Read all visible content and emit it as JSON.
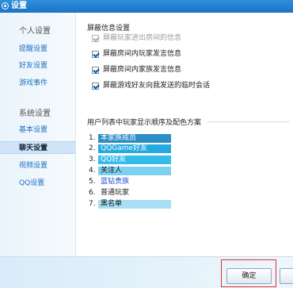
{
  "window": {
    "title": "设置"
  },
  "sidebar": {
    "groups": [
      {
        "label": "个人设置",
        "items": [
          {
            "label": "提醒设置"
          },
          {
            "label": "好友设置"
          },
          {
            "label": "游戏事件"
          }
        ]
      },
      {
        "label": "系统设置",
        "items": [
          {
            "label": "基本设置"
          },
          {
            "label": "聊天设置",
            "active": true
          },
          {
            "label": "视频设置"
          },
          {
            "label": "QQ设置"
          }
        ]
      }
    ]
  },
  "shield": {
    "title": "屏蔽信息设置",
    "options": [
      {
        "label": "屏蔽玩家进出房间的信息",
        "checked": true,
        "disabled": true
      },
      {
        "label": "屏蔽房间内玩家发言信息",
        "checked": true,
        "disabled": false
      },
      {
        "label": "屏蔽房间内家族发言信息",
        "checked": true,
        "disabled": false
      },
      {
        "label": "屏蔽游戏好友向我发送的临时会话",
        "checked": true,
        "disabled": false
      }
    ]
  },
  "user_order": {
    "title": "用户列表中玩家显示顺序及配色方案",
    "items": [
      {
        "num": "1.",
        "label": "本家族成员",
        "bg": "#2c8ec6",
        "fg": "#ffffff"
      },
      {
        "num": "2.",
        "label": "QQGame好友",
        "bg": "#26a9df",
        "fg": "#ffffff"
      },
      {
        "num": "3.",
        "label": "QQ好友",
        "bg": "#34bdea",
        "fg": "#ffffff"
      },
      {
        "num": "4.",
        "label": "关注人",
        "bg": "#7fd0f0",
        "fg": "#111111"
      },
      {
        "num": "5.",
        "label": "蓝钻贵族",
        "bg": "",
        "fg": "#1a4fd6"
      },
      {
        "num": "6.",
        "label": "普通玩家",
        "bg": "",
        "fg": "#222222"
      },
      {
        "num": "7.",
        "label": "黑名单",
        "bg": "#a9def4",
        "fg": "#111111"
      }
    ]
  },
  "footer": {
    "ok_label": "确定"
  }
}
